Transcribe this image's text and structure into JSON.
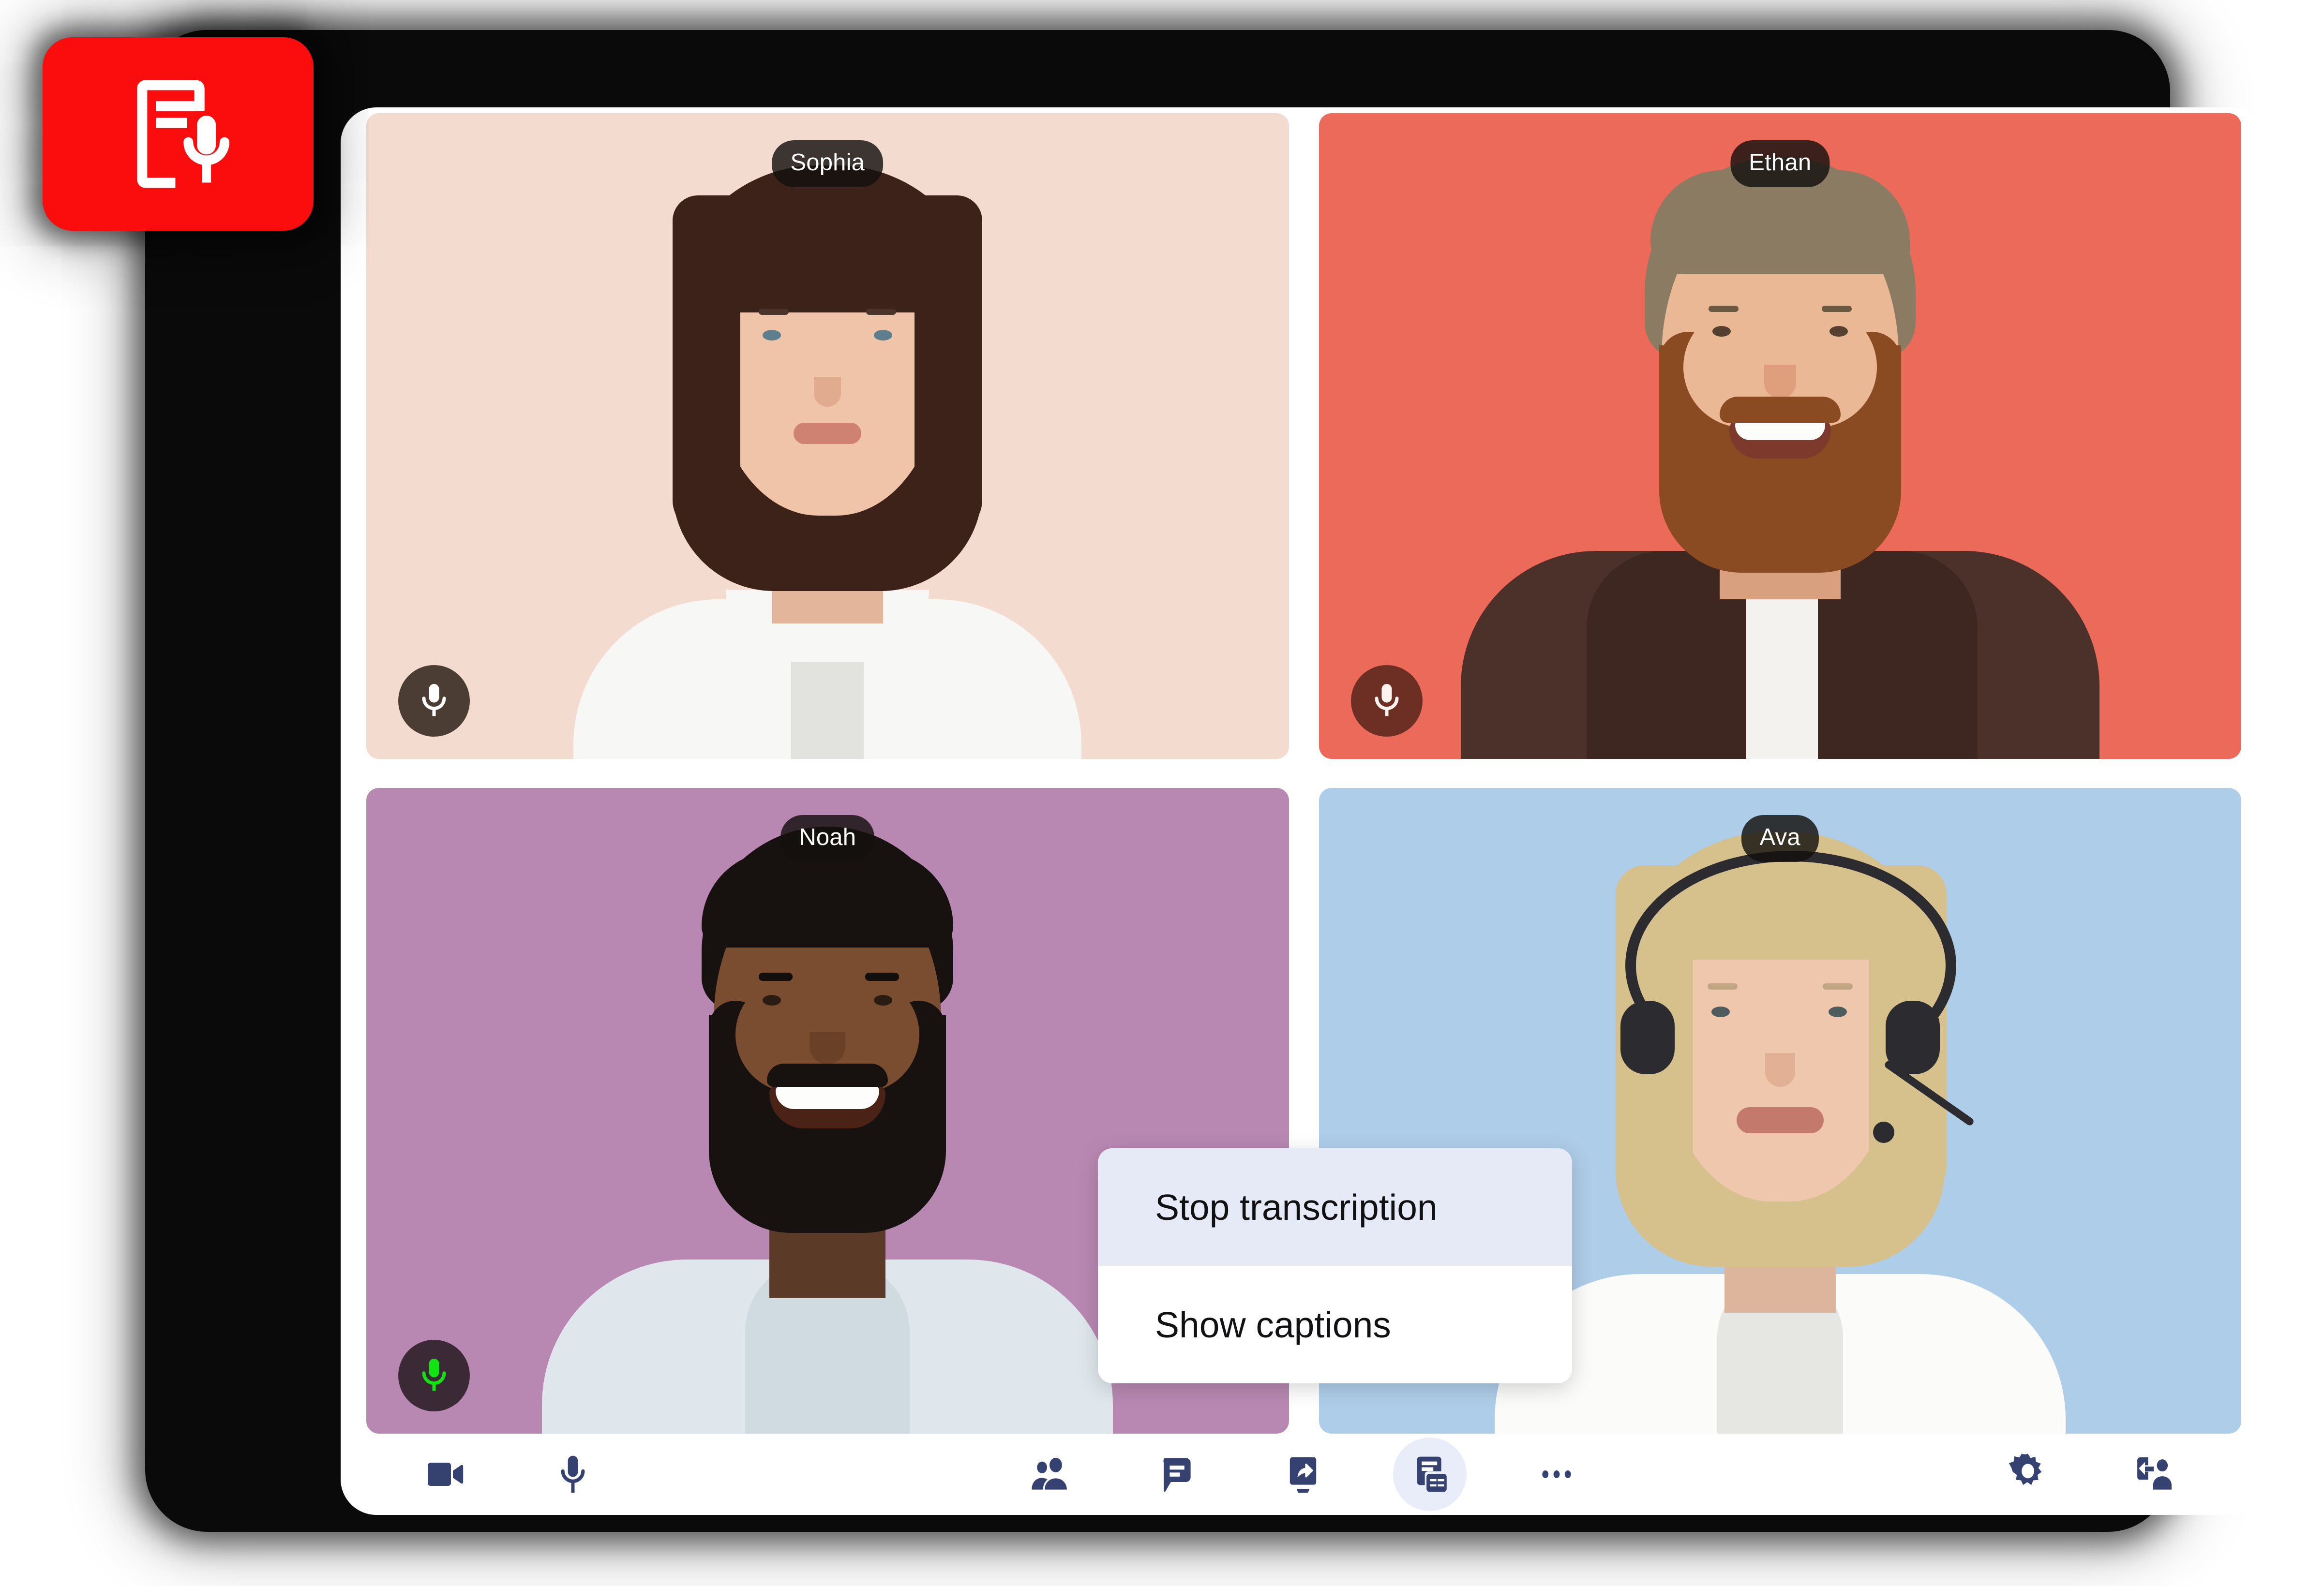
{
  "app": {
    "title": "Video meeting",
    "accent_color": "#fb0d0d",
    "toolbar_icon_color": "#354170",
    "active_pill_color": "#e9edf9",
    "menu_highlight_color": "#e6eaf7"
  },
  "badge": {
    "name": "transcription-recording-badge",
    "icon": "document-microphone-icon",
    "color": "#fb0d0d",
    "icon_color": "#ffffff"
  },
  "participants": [
    {
      "name": "Sophia",
      "tile_color": "#f4dbd0",
      "mic_state": "muted",
      "mic_badge_color": "#4b3c34",
      "mic_icon_color": "#ffffff",
      "mic_icon": "microphone-icon"
    },
    {
      "name": "Ethan",
      "tile_color": "#ec6a5a",
      "mic_state": "muted",
      "mic_badge_color": "#6d2f24",
      "mic_icon_color": "#fdf3ef",
      "mic_icon": "microphone-icon"
    },
    {
      "name": "Noah",
      "tile_color": "#b888b2",
      "mic_state": "active",
      "mic_badge_color": "#3b2a36",
      "mic_icon_color": "#12e312",
      "mic_icon": "microphone-icon"
    },
    {
      "name": "Ava",
      "tile_color": "#aecde8",
      "mic_state": "none",
      "mic_badge_color": "",
      "mic_icon_color": "",
      "mic_icon": ""
    }
  ],
  "context_menu": {
    "items": [
      {
        "label": "Stop transcription",
        "highlighted": true
      },
      {
        "label": "Show captions",
        "highlighted": false
      }
    ]
  },
  "toolbar": {
    "left": [
      {
        "label": "Camera",
        "icon": "video-camera-icon",
        "active": false
      },
      {
        "label": "Microphone",
        "icon": "microphone-icon",
        "active": false
      }
    ],
    "center": [
      {
        "label": "Participants",
        "icon": "people-icon",
        "active": false
      },
      {
        "label": "Chat",
        "icon": "chat-bubble-icon",
        "active": false
      },
      {
        "label": "Share screen",
        "icon": "screen-share-icon",
        "active": false
      },
      {
        "label": "Transcription and captions",
        "icon": "transcription-cc-icon",
        "active": true
      },
      {
        "label": "More options",
        "icon": "more-horizontal-icon",
        "active": false
      }
    ],
    "right": [
      {
        "label": "Settings",
        "icon": "gear-icon",
        "active": false
      },
      {
        "label": "Leave meeting",
        "icon": "leave-meeting-icon",
        "active": false
      }
    ]
  }
}
